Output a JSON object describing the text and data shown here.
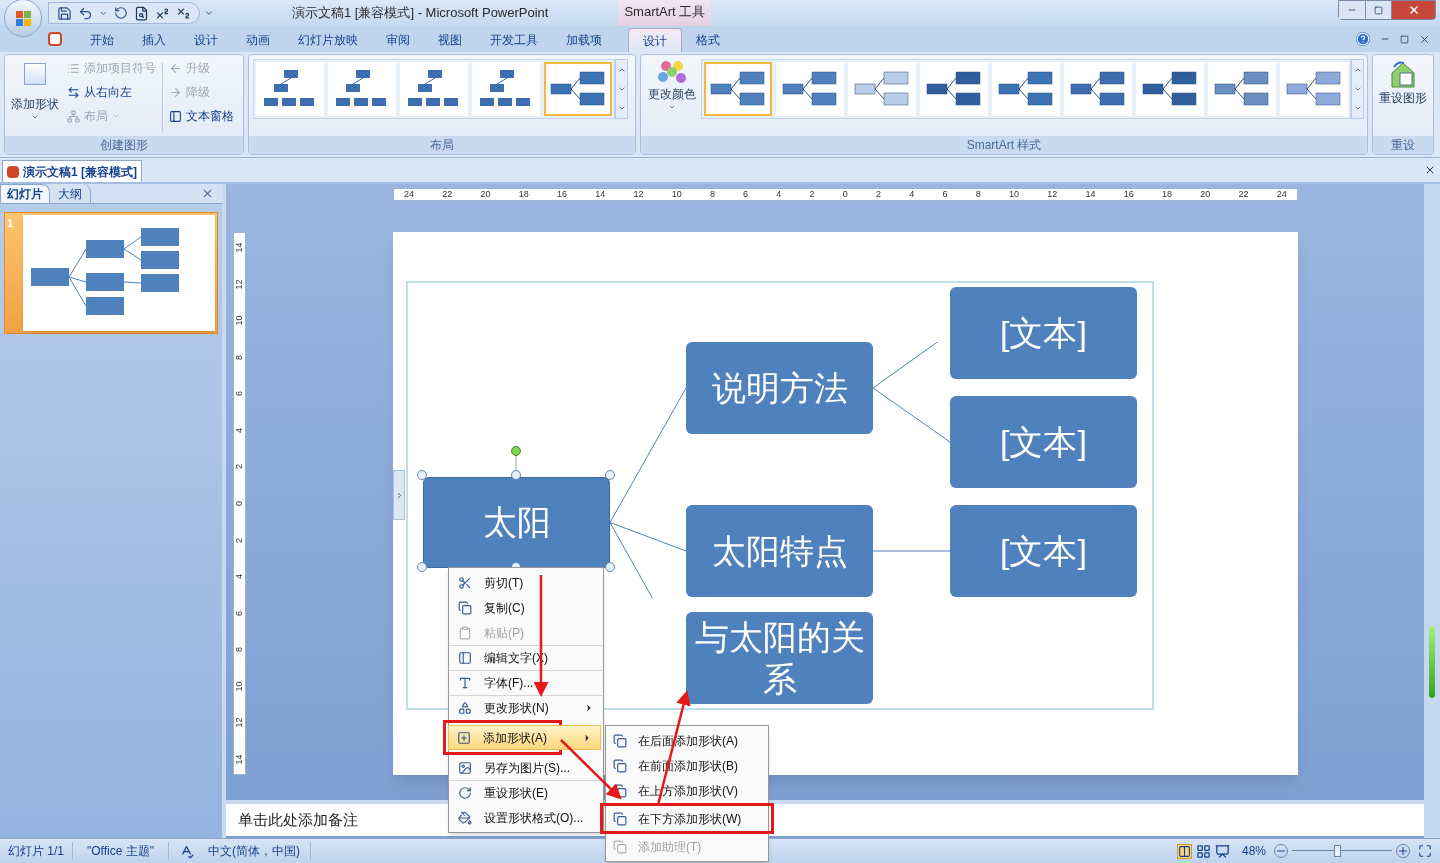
{
  "title_bar": {
    "title": "演示文稿1 [兼容模式] - Microsoft PowerPoint",
    "context_group": "SmartArt 工具"
  },
  "ribbon_tabs": [
    {
      "label": "开始",
      "selected": false
    },
    {
      "label": "插入",
      "selected": false
    },
    {
      "label": "设计",
      "selected": false
    },
    {
      "label": "动画",
      "selected": false
    },
    {
      "label": "幻灯片放映",
      "selected": false
    },
    {
      "label": "审阅",
      "selected": false
    },
    {
      "label": "视图",
      "selected": false
    },
    {
      "label": "开发工具",
      "selected": false
    },
    {
      "label": "加载项",
      "selected": false
    },
    {
      "label": "设计",
      "selected": true
    },
    {
      "label": "格式",
      "selected": false
    }
  ],
  "create_group": {
    "title": "创建图形",
    "add_shape": "添加形状",
    "items": [
      {
        "label": "添加项目符号",
        "disabled": true
      },
      {
        "label": "从右向左",
        "disabled": false
      },
      {
        "label": "布局",
        "disabled": true
      },
      {
        "label": "升级",
        "disabled": true
      },
      {
        "label": "降级",
        "disabled": true
      },
      {
        "label": "文本窗格",
        "disabled": false
      }
    ]
  },
  "layout_group": {
    "title": "布局",
    "layouts": [
      {
        "selected": false
      },
      {
        "selected": false
      },
      {
        "selected": false
      },
      {
        "selected": false
      },
      {
        "selected": true
      }
    ]
  },
  "styles_group": {
    "title": "SmartArt 样式",
    "change_colors": "更改颜色",
    "styles": [
      {
        "selected": true
      },
      {
        "selected": false
      },
      {
        "selected": false
      },
      {
        "selected": false
      },
      {
        "selected": false
      },
      {
        "selected": false
      },
      {
        "selected": false
      },
      {
        "selected": false
      },
      {
        "selected": false
      }
    ]
  },
  "reset_group": {
    "title": "重设",
    "button": "重设图形"
  },
  "document_tab": "演示文稿1 [兼容模式]",
  "pane_tabs": [
    {
      "label": "幻灯片",
      "selected": true
    },
    {
      "label": "大纲",
      "selected": false
    }
  ],
  "slide_thumbnail": {
    "number": "1",
    "selected": true
  },
  "ruler_horizontal": [
    "24",
    "22",
    "20",
    "18",
    "16",
    "14",
    "12",
    "10",
    "8",
    "6",
    "4",
    "2",
    "0",
    "2",
    "4",
    "6",
    "8",
    "10",
    "12",
    "14",
    "16",
    "18",
    "20",
    "22",
    "24"
  ],
  "ruler_vertical": [
    "14",
    "12",
    "10",
    "8",
    "6",
    "4",
    "2",
    "0",
    "2",
    "4",
    "6",
    "8",
    "10",
    "12",
    "14"
  ],
  "diagram": {
    "root": "太阳",
    "branches": [
      {
        "label": "说明方法",
        "children": [
          {
            "label": "[文本]"
          },
          {
            "label": "[文本]"
          }
        ]
      },
      {
        "label": "太阳特点",
        "children": [
          {
            "label": "[文本]"
          }
        ]
      },
      {
        "label": "与太阳的关系"
      }
    ]
  },
  "notes_placeholder": "单击此处添加备注",
  "context_menu": {
    "items": [
      {
        "label": "剪切(T)",
        "disabled": false,
        "selected": false,
        "submenu": false,
        "separator_before": false
      },
      {
        "label": "复制(C)",
        "disabled": false,
        "selected": false,
        "submenu": false,
        "separator_before": false
      },
      {
        "label": "粘贴(P)",
        "disabled": true,
        "selected": false,
        "submenu": false,
        "separator_before": false
      },
      {
        "label": "编辑文字(X)",
        "disabled": false,
        "selected": false,
        "submenu": false,
        "separator_before": true
      },
      {
        "label": "字体(F)...",
        "disabled": false,
        "selected": false,
        "submenu": false,
        "separator_before": true
      },
      {
        "label": "更改形状(N)",
        "disabled": false,
        "selected": false,
        "submenu": true,
        "separator_before": true
      },
      {
        "label": "添加形状(A)",
        "disabled": false,
        "selected": true,
        "submenu": true,
        "separator_before": false
      },
      {
        "label": "另存为图片(S)...",
        "disabled": false,
        "selected": false,
        "submenu": false,
        "separator_before": false
      },
      {
        "label": "重设形状(E)",
        "disabled": false,
        "selected": false,
        "submenu": false,
        "separator_before": true
      },
      {
        "label": "设置形状格式(O)...",
        "disabled": false,
        "selected": false,
        "submenu": false,
        "separator_before": false
      }
    ]
  },
  "submenu": {
    "items": [
      {
        "label": "在后面添加形状(A)",
        "disabled": false
      },
      {
        "label": "在前面添加形状(B)",
        "disabled": false
      },
      {
        "label": "在上方添加形状(V)",
        "disabled": false
      },
      {
        "label": "在下方添加形状(W)",
        "disabled": false
      },
      {
        "label": "添加助理(T)",
        "disabled": true
      }
    ]
  },
  "status_bar": {
    "slide": "幻灯片 1/1",
    "theme": "\"Office 主题\"",
    "language": "中文(简体，中国)",
    "zoom": "48%",
    "zoom_slider": {
      "level": 0.45
    }
  }
}
